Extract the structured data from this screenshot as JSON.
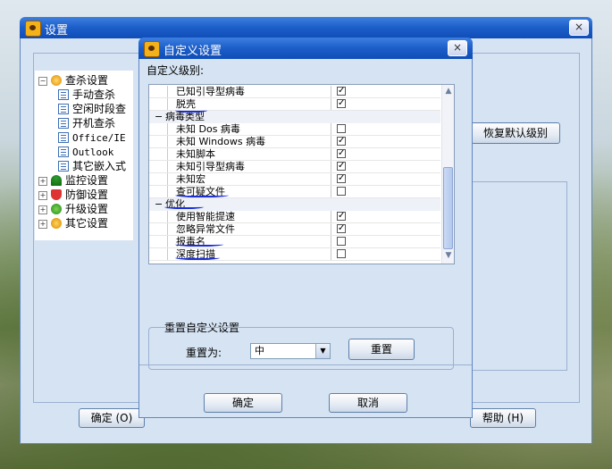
{
  "settings_window": {
    "title": "设置",
    "close": "×",
    "tree": {
      "root": "查杀设置",
      "children": [
        "手动查杀",
        "空闲时段查",
        "开机查杀",
        "Office/IE",
        "Outlook",
        "其它嵌入式"
      ],
      "others": [
        "监控设置",
        "防御设置",
        "升级设置",
        "其它设置"
      ]
    },
    "restore_button": "恢复默认级别",
    "ok_button": "确定 (O)",
    "help_button": "帮助 (H)"
  },
  "dialog": {
    "title": "自定义设置",
    "close": "×",
    "level_label": "自定义级别:",
    "rows": [
      {
        "type": "item",
        "label": "已知引导型病毒",
        "checked": true
      },
      {
        "type": "item",
        "label": "脱壳",
        "checked": true
      },
      {
        "type": "group",
        "label": "病毒类型",
        "sign": "−"
      },
      {
        "type": "item",
        "label": "未知 Dos 病毒",
        "checked": false
      },
      {
        "type": "item",
        "label": "未知 Windows 病毒",
        "checked": true
      },
      {
        "type": "item",
        "label": "未知脚本",
        "checked": true
      },
      {
        "type": "item",
        "label": "未知引导型病毒",
        "checked": true
      },
      {
        "type": "item",
        "label": "未知宏",
        "checked": true
      },
      {
        "type": "item",
        "label": "查可疑文件",
        "checked": false
      },
      {
        "type": "group",
        "label": "优化",
        "sign": "−"
      },
      {
        "type": "item",
        "label": "使用智能提速",
        "checked": true
      },
      {
        "type": "item",
        "label": "忽略异常文件",
        "checked": true
      },
      {
        "type": "item",
        "label": "报毒名",
        "checked": false
      },
      {
        "type": "item",
        "label": "深度扫描",
        "checked": false
      }
    ],
    "reset_group": {
      "legend": "重置自定义设置",
      "reset_to_label": "重置为:",
      "selected_value": "中",
      "reset_button": "重置"
    },
    "ok_button": "确定",
    "cancel_button": "取消"
  }
}
